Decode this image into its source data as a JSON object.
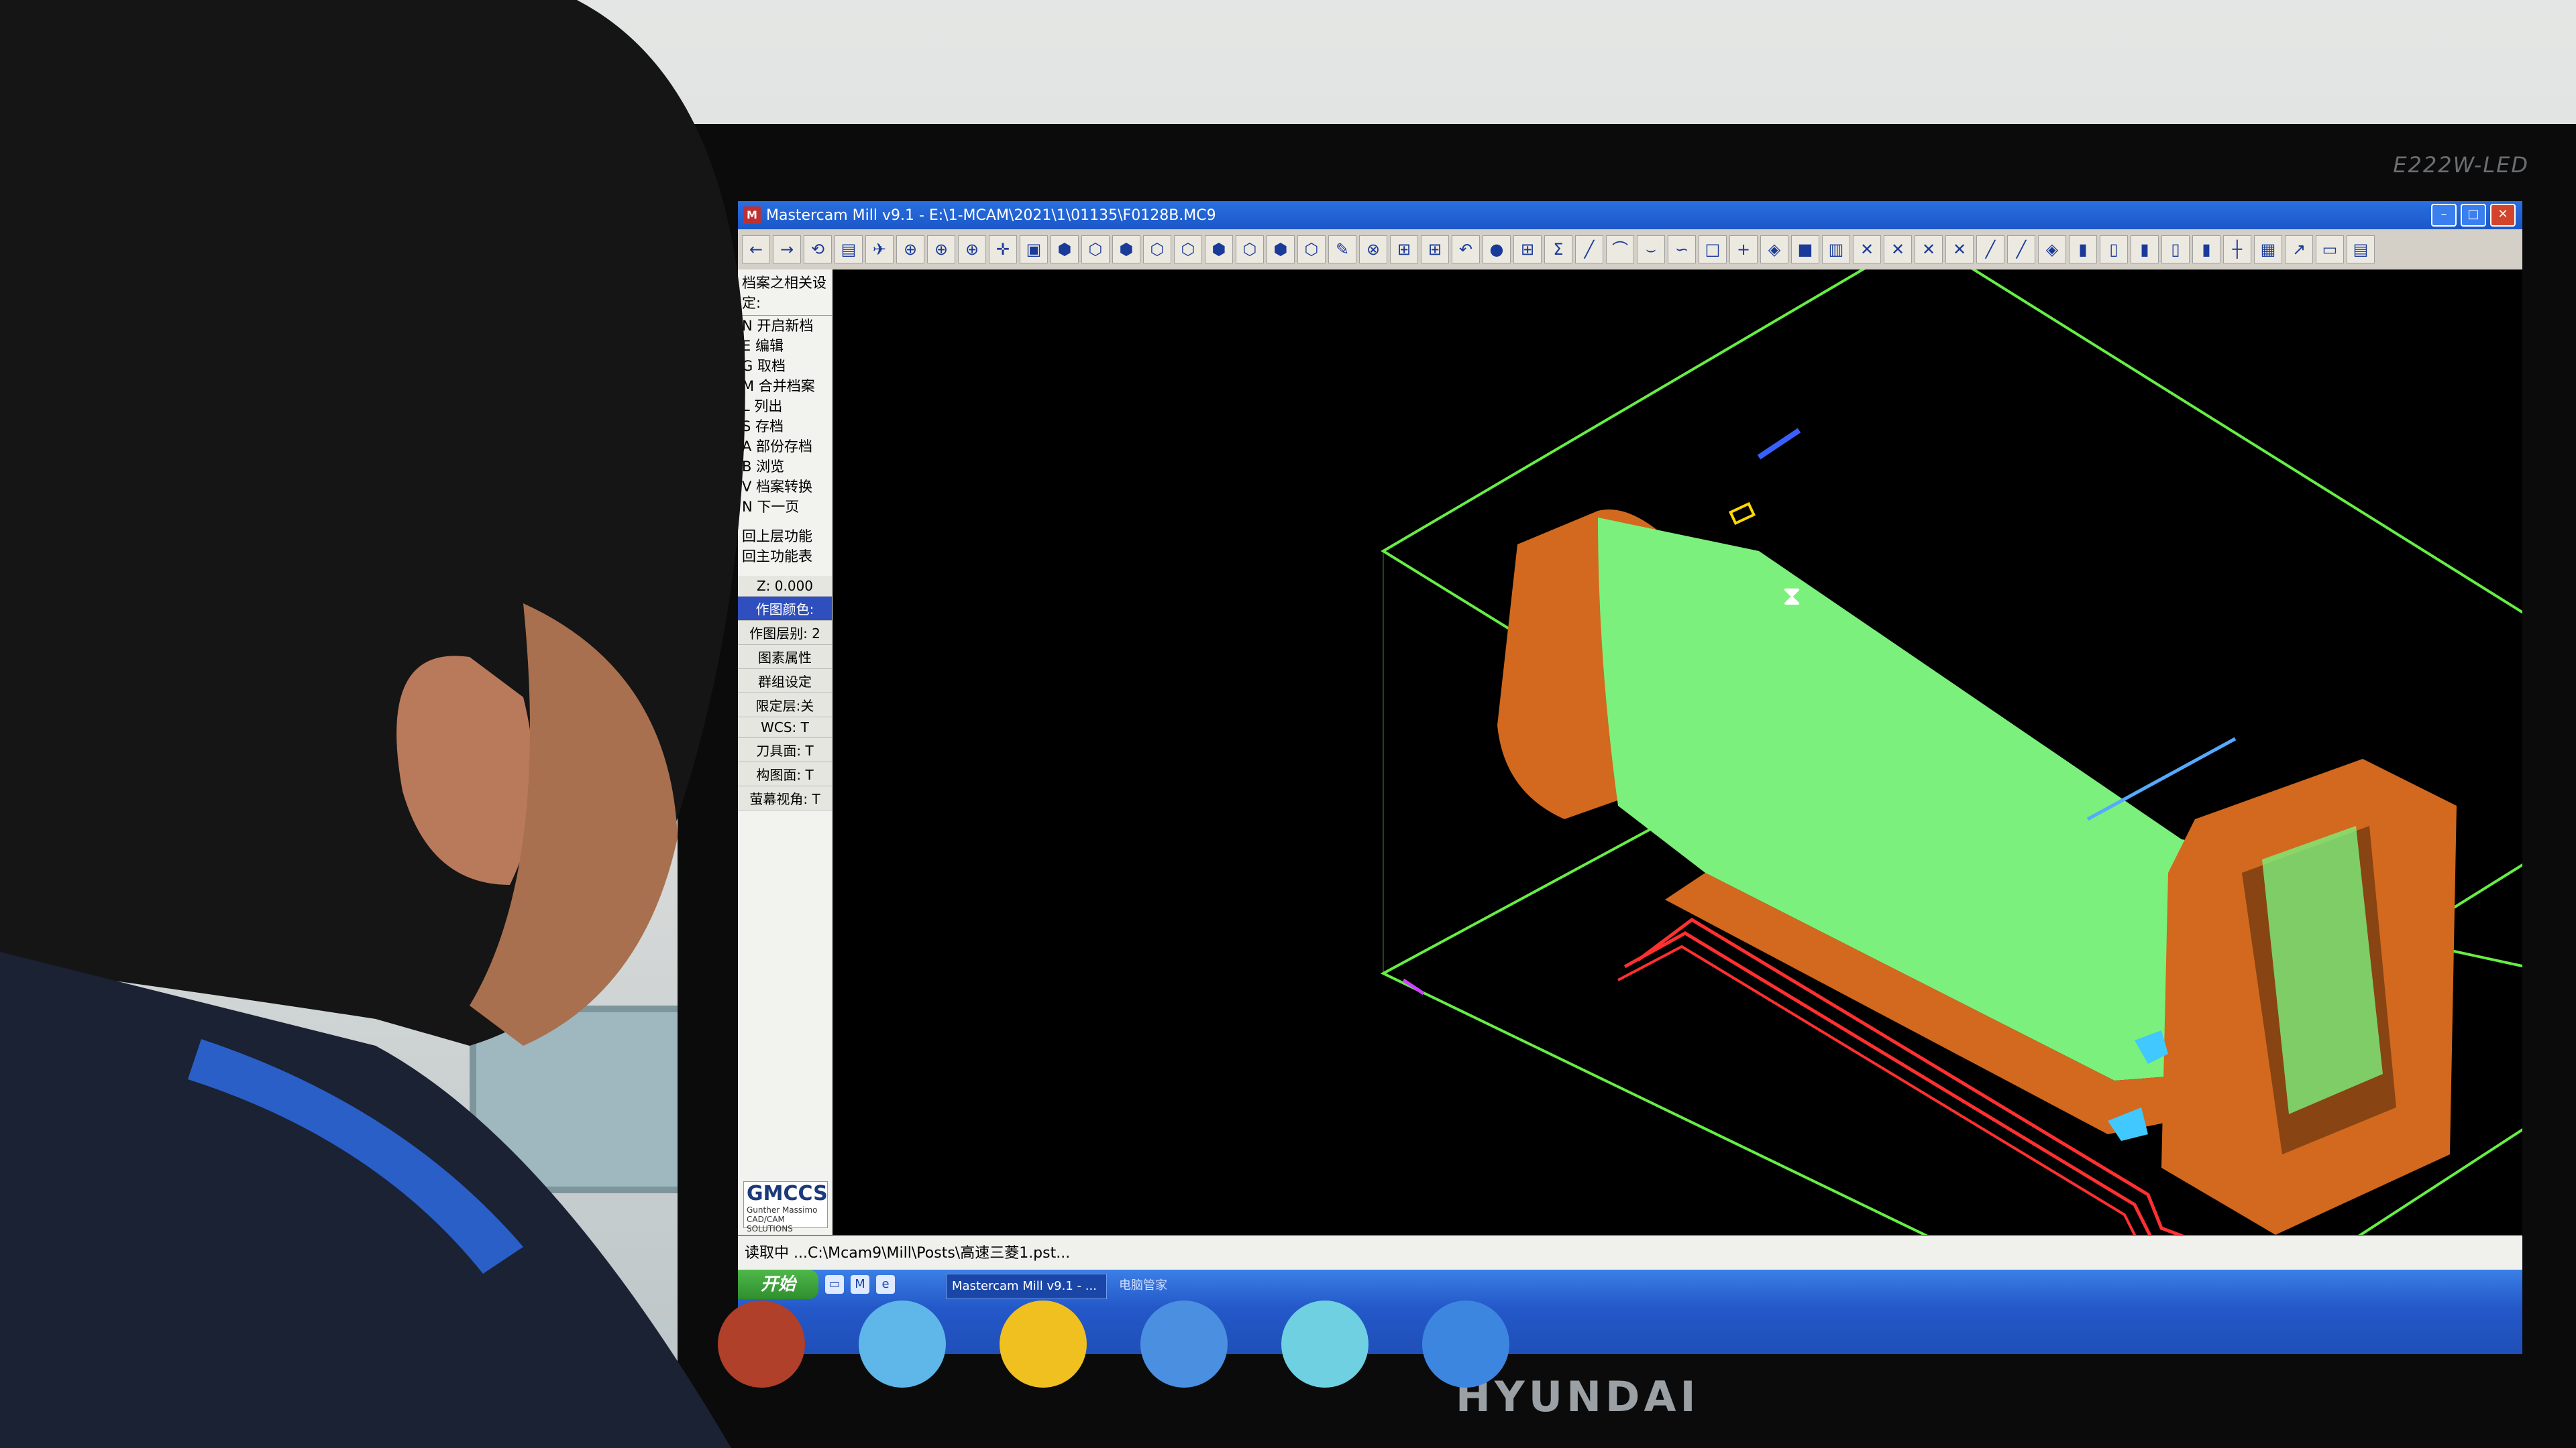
{
  "monitor": {
    "model_label": "E222W-LED",
    "brand": "HYUNDAI"
  },
  "window": {
    "title": "Mastercam Mill v9.1 - E:\\1-MCAM\\2021\\1\\01135\\F0128B.MC9"
  },
  "toolbar": {
    "icons": [
      "←",
      "→",
      "⟲",
      "▤",
      "✈",
      "⊕",
      "⊕",
      "⊕",
      "✛",
      "▣",
      "⬢",
      "⬡",
      "⬢",
      "⬡",
      "⬡",
      "⬢",
      "⬡",
      "⬢",
      "⬡",
      "✎",
      "⊗",
      "⊞",
      "⊞",
      "↶",
      "●",
      "⊞",
      "Σ",
      "╱",
      "⌒",
      "⌣",
      "∽",
      "□",
      "+",
      "◈",
      "■",
      "▥",
      "✕",
      "✕",
      "✕",
      "✕",
      "╱",
      "╱",
      "◈",
      "▮",
      "▯",
      "▮",
      "▯",
      "▮",
      "┼",
      "▦",
      "↗",
      "▭",
      "▤"
    ]
  },
  "menu": {
    "header": "档案之相关设定:",
    "items": [
      "N 开启新档",
      "E 编辑",
      "G 取档",
      "M 合并档案",
      "L 列出",
      "S 存档",
      "A 部份存档",
      "B 浏览",
      "V 档案转换",
      "N 下一页"
    ],
    "back_items": [
      "回上层功能",
      "回主功能表"
    ]
  },
  "status": {
    "rows": [
      "Z: 0.000",
      "作图颜色:",
      "作图层别: 2",
      "图素属性",
      "群组设定",
      "限定层:关",
      "WCS: T",
      "刀具面: T",
      "构图面: T",
      "萤幕视角: T"
    ]
  },
  "logo": {
    "main": "GMCCS",
    "sub1": "Gunther Massimo",
    "sub2": "CAD/CAM SOLUTIONS"
  },
  "prompt": {
    "text": "读取中 ...C:\\Mcam9\\Mill\\Posts\\高速三菱1.pst..."
  },
  "taskbar": {
    "start_label": "开始",
    "app_label": "Mastercam Mill v9.1 - ...",
    "app2_label": "电脑管家"
  },
  "colors": {
    "part_green": "#7cf07c",
    "part_orange": "#d2691e",
    "boundary_green": "#66ee44",
    "toolpath_red": "#ff3030",
    "accent_blue": "#3a5fff"
  }
}
